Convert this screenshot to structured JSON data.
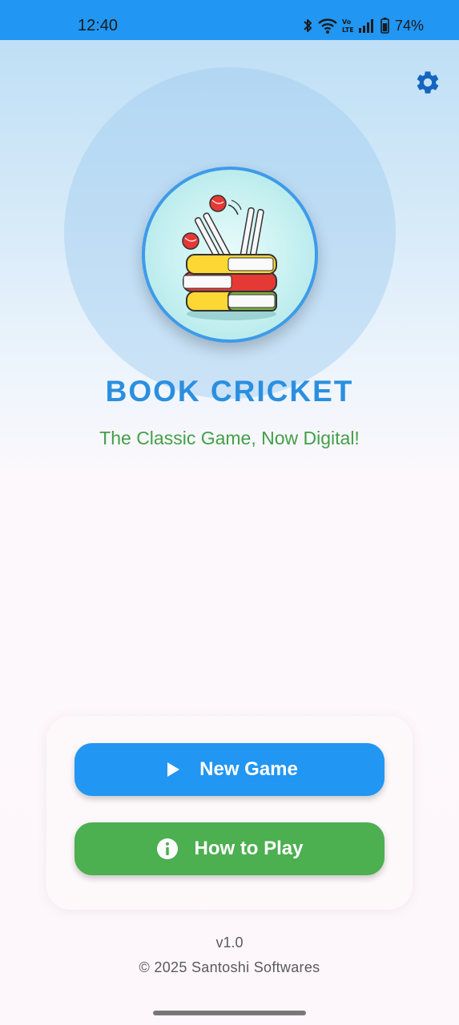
{
  "status_bar": {
    "time": "12:40",
    "battery": "74%",
    "icons": [
      "bluetooth-icon",
      "wifi-icon",
      "volte-icon",
      "signal-icon",
      "battery-icon"
    ],
    "color": "#2196f3"
  },
  "header": {
    "settings_icon": "gear-icon"
  },
  "hero": {
    "title": "BOOK CRICKET",
    "subtitle": "The Classic Game, Now Digital!",
    "logo": "books-and-wickets-logo",
    "title_color": "#2b8fe0",
    "subtitle_color": "#43a047"
  },
  "actions": {
    "new_game": {
      "label": "New Game",
      "icon": "play-icon",
      "color": "#2196f3"
    },
    "how_to_play": {
      "label": "How to Play",
      "icon": "info-icon",
      "color": "#4caf50"
    }
  },
  "footer": {
    "version": "v1.0",
    "copyright": "© 2025 Santoshi Softwares"
  }
}
